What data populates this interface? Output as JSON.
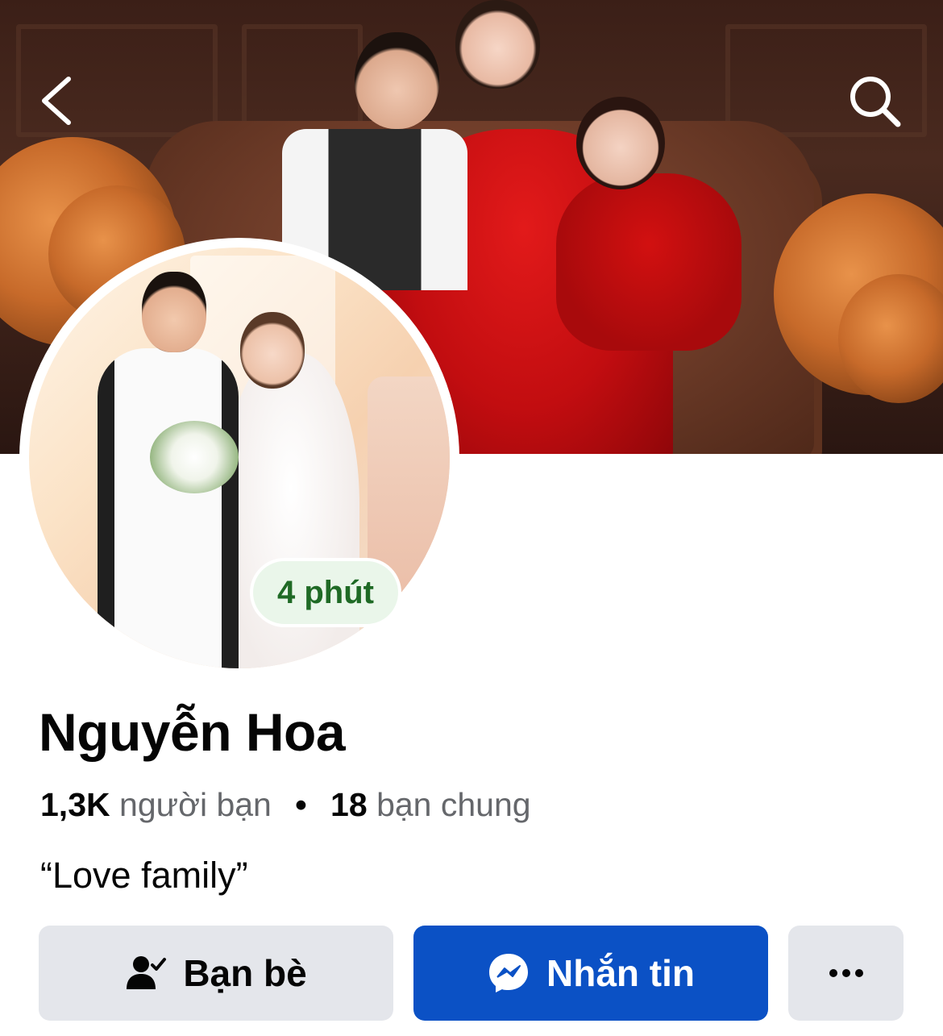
{
  "profile": {
    "name": "Nguyễn Hoa",
    "status_badge": "4 phút",
    "friends_count": "1,3K",
    "friends_label": "người bạn",
    "separator": "•",
    "mutual_count": "18",
    "mutual_label": "bạn chung",
    "bio": "“Love family”"
  },
  "actions": {
    "friends_label": "Bạn bè",
    "message_label": "Nhắn tin",
    "more_label": "•••"
  },
  "icons": {
    "back": "chevron-left-icon",
    "search": "search-icon",
    "friends": "friend-check-icon",
    "messenger": "messenger-icon",
    "more": "more-icon"
  },
  "colors": {
    "primary_button": "#0b51c5",
    "secondary_button": "#e4e6eb",
    "status_badge_bg": "#eaf6ea",
    "status_badge_text": "#1f6a25",
    "muted_text": "#65676b"
  }
}
